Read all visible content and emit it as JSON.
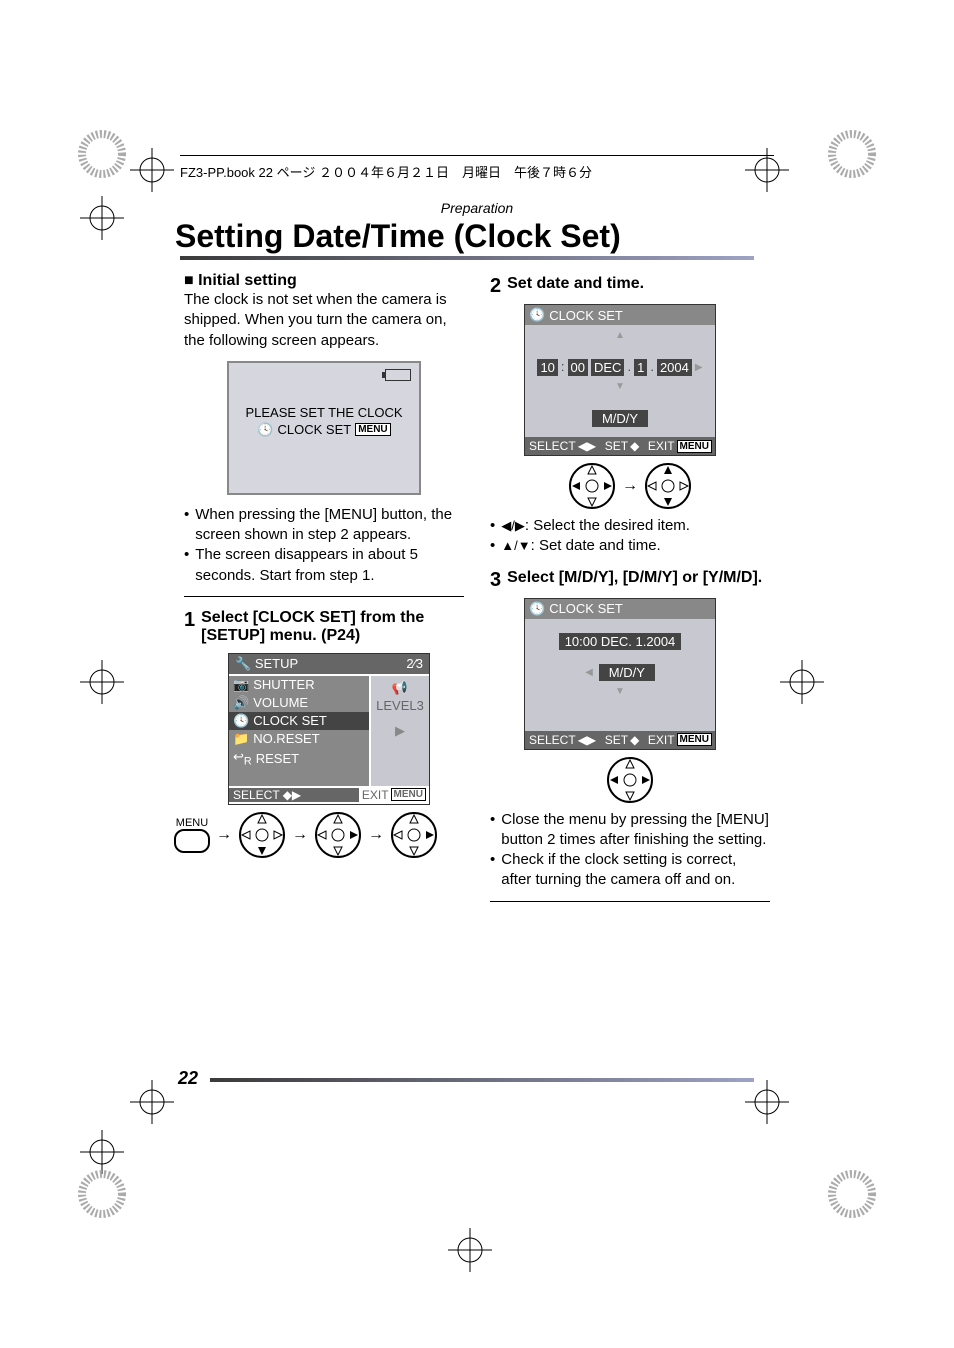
{
  "printer_line": "FZ3-PP.book  22 ページ  ２００４年６月２１日　月曜日　午後７時６分",
  "prep_header": "Preparation",
  "title": "Setting Date/Time (Clock Set)",
  "initial": {
    "heading_prefix": "∫",
    "heading": "Initial setting",
    "text": "The clock is not set when the camera is shipped. When you turn the camera on, the following screen appears.",
    "screen_please": "PLEASE SET THE CLOCK",
    "screen_clock": "CLOCK SET",
    "screen_menu": "MENU",
    "bullet1": "When pressing the [MENU] button, the screen shown in step 2 appears.",
    "bullet2": "The screen disappears in about 5 seconds. Start from step 1."
  },
  "step1": {
    "num": "1",
    "label": "Select [CLOCK SET] from the [SETUP] menu. (P24)",
    "setup": {
      "title": "SETUP",
      "page": "2∕3",
      "items": [
        "SHUTTER",
        "VOLUME",
        "CLOCK SET",
        "NO.RESET",
        "RESET"
      ],
      "right_top": "LEVEL3",
      "select": "SELECT",
      "exit": "EXIT",
      "menu": "MENU"
    },
    "menu_label": "MENU"
  },
  "step2": {
    "num": "2",
    "label": "Set date and time.",
    "cs": {
      "title": "CLOCK SET",
      "hour": "10",
      "min": "00",
      "sep": ":",
      "month": "DEC",
      "dot": ".",
      "day": "1",
      "year": "2004",
      "format": "M/D/Y",
      "select": "SELECT",
      "set": "SET",
      "exit": "EXIT",
      "menu": "MENU"
    },
    "bullet1": ": Select the desired item.",
    "bullet2": ": Set date and time."
  },
  "step3": {
    "num": "3",
    "label": "Select [M/D/Y], [D/M/Y] or [Y/M/D].",
    "cs": {
      "title": "CLOCK SET",
      "date": "10:00  DEC.  1.2004",
      "format": "M/D/Y",
      "select": "SELECT",
      "set": "SET",
      "exit": "EXIT",
      "menu": "MENU"
    },
    "bullet1": "Close the menu by pressing the [MENU] button 2 times after finishing the setting.",
    "bullet2": "Check if the clock setting is correct, after turning the camera off and on."
  },
  "page_number": "22"
}
